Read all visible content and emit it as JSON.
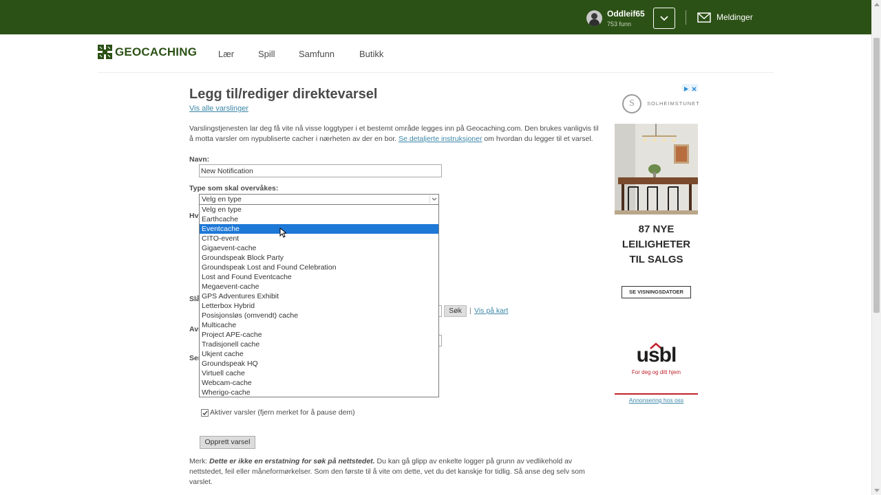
{
  "header": {
    "username": "Oddleif65",
    "finds": "753 funn",
    "messages_label": "Meldinger"
  },
  "nav": {
    "logo_text": "GEOCACHING",
    "items": [
      "Lær",
      "Spill",
      "Samfunn",
      "Butikk"
    ]
  },
  "page": {
    "title": "Legg til/rediger direktevarsel",
    "view_all_link": "Vis alle varslinger",
    "intro_text": "Varslingstjenesten lar deg få vite nå visse loggtyper i et bestemt område legges inn på Geocaching.com. Den brukes vanligvis til å motta varsler om nypubliserte cacher i nærheten av der en bor. ",
    "intro_link": "Se detaljerte instruksjoner",
    "intro_after": " om hvordan du legger til et varsel."
  },
  "form": {
    "name_label": "Navn:",
    "name_value": "New Notification",
    "type_label": "Type som skal overvåkes:",
    "type_selected": "Velg en type",
    "partial_labels": [
      "Hvi",
      "Slå",
      "Avs",
      "Ser"
    ],
    "type_options": [
      "Velg en type",
      "Earthcache",
      "Eventcache",
      "CITO-event",
      "Gigaevent-cache",
      "Groundspeak Block Party",
      "Groundspeak Lost and Found Celebration",
      "Lost and Found Eventcache",
      "Megaevent-cache",
      "GPS Adventures Exhibit",
      "Letterbox Hybrid",
      "Posisjonsløs (omvendt) cache",
      "Multicache",
      "Project APE-cache",
      "Tradisjonell cache",
      "Ukjent cache",
      "Groundspeak HQ",
      "Virtuell cache",
      "Webcam-cache",
      "Wherigo-cache"
    ],
    "highlighted_option": "Eventcache",
    "search_button": "Søk",
    "pipe": "|",
    "map_link": "Vis på kart",
    "activate_label": "Aktiver varsler (fjern merket for å pause dem)",
    "activate_checked": true,
    "create_button": "Opprett varsel",
    "note_prefix": "Merk: ",
    "note_emphasis": "Dette er ikke en erstatning for søk på nettstedet.",
    "note_rest": " Du kan gå glipp av enkelte logger på grunn av vedlikehold av nettstedet, feil eller måneformørkelser. Som den første til å vite om dette, vet du det kanskje for tidlig. Så anse deg selv som varslet."
  },
  "ad": {
    "brand": "SOLHEIMSTUNET",
    "brand_initial": "S",
    "headline": "87 NYE LEILIGHETER TIL SALGS",
    "cta": "SE VISNINGSDATOER",
    "usbl_name": "usbl",
    "usbl_tagline": "For deg og ditt hjem",
    "advertise_link": "Annonsering hos oss"
  },
  "colors": {
    "header_bg": "#2c5116",
    "link": "#3b86a7",
    "selected_option": "#1e78d6",
    "usbl_red": "#c0222b"
  }
}
